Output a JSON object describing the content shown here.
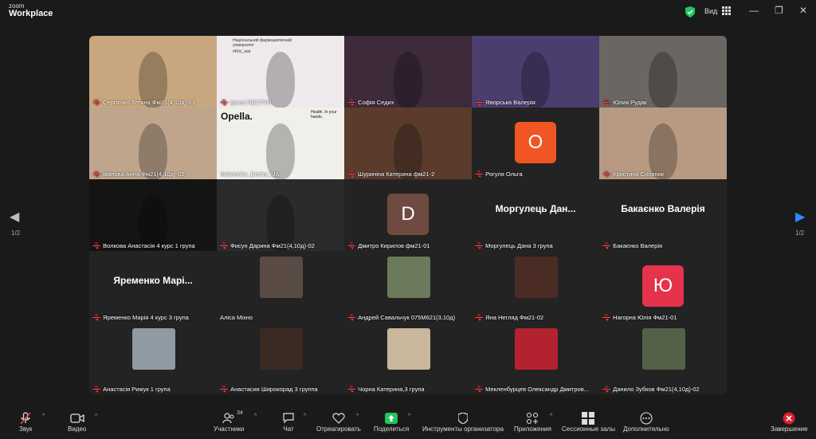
{
  "app": {
    "logo_line1": "zoom",
    "logo_line2": "Workplace",
    "view_label": "Вид"
  },
  "pager": {
    "left_page": "1/2",
    "right_page": "1/2"
  },
  "tiles": [
    {
      "name": "Сергієнко Тетяна Фм21(4,10д)-03",
      "bg": "#c9a77e",
      "muted": true
    },
    {
      "name": "Ірина ПЕСТУН",
      "bg": "#efe9ee",
      "muted": true,
      "slide_text": "Національний фармацевтичний університет",
      "slide_tag": "#Kfs/_stat"
    },
    {
      "name": "Софія Седих",
      "bg": "#3d2a3a",
      "muted": true
    },
    {
      "name": "Яворська Валерія",
      "bg": "#4b3d6e",
      "muted": true
    },
    {
      "name": "Юлия Рудак",
      "bg": "#6a6661",
      "muted": true
    },
    {
      "name": "Іванова Анна Фм21(4,10д)-02",
      "bg": "#bfa58c",
      "muted": true
    },
    {
      "name": "Matvienko_Dmitry_UA",
      "bg": "#f1efe9",
      "muted": false,
      "brand": "Opella.",
      "brand_tag": "Health. In your hands."
    },
    {
      "name": "Шуриніна Катерина фм21-2",
      "bg": "#5a3b2c",
      "muted": true
    },
    {
      "name": "Рогуля Ольга",
      "bg": "#232323",
      "muted": true,
      "initial": "О",
      "initial_color": "#f05523"
    },
    {
      "name": "Кристина Соляник",
      "bg": "#b89a82",
      "muted": true
    },
    {
      "name": "Волкова Анастасія 4 курс 1 група",
      "bg": "#141414",
      "muted": true
    },
    {
      "name": "Фисун Дарина Фм21(4,10д)-02",
      "bg": "#2b2b2b",
      "muted": true
    },
    {
      "name": "Дмитро Кирилов фм21-01",
      "bg": "#232323",
      "muted": true,
      "initial": "D",
      "initial_color": "#6e4a40"
    },
    {
      "name": "Моргулець Дана 3 група",
      "bg": "#232323",
      "muted": true,
      "display_name": "Моргулець Дан..."
    },
    {
      "name": "Бакаєнко Валерія",
      "bg": "#232323",
      "muted": true,
      "display_name": "Бакаєнко Валерія"
    },
    {
      "name": "Яременко Марія 4 курс 3 група",
      "bg": "#232323",
      "muted": true,
      "display_name": "Яременко Марі..."
    },
    {
      "name": "Аліса Міхно",
      "bg": "#232323",
      "muted": false,
      "photo": "#5a4a44"
    },
    {
      "name": "Андрей Савальчук 075М621(3,10д)",
      "bg": "#232323",
      "muted": true,
      "photo": "#6b7a5a"
    },
    {
      "name": "Яна Негляд Фм21-02",
      "bg": "#232323",
      "muted": true,
      "photo": "#4a2c24"
    },
    {
      "name": "Нагорна Юлія Фм21-01",
      "bg": "#232323",
      "muted": true,
      "initial": "Ю",
      "initial_color": "#e5334b"
    },
    {
      "name": "Анастасія Рижук 1 група",
      "bg": "#232323",
      "muted": true,
      "photo": "#8f9aa2"
    },
    {
      "name": "Анастасия Широкорад 3 группа",
      "bg": "#232323",
      "muted": true,
      "photo": "#3a2a22"
    },
    {
      "name": "Чорна Катерина,3 група",
      "bg": "#232323",
      "muted": true,
      "photo": "#c8b79a"
    },
    {
      "name": "Мекленбурцев Олександр Дмитров...",
      "bg": "#232323",
      "muted": true,
      "photo": "#b3222e"
    },
    {
      "name": "Данило Зубков Фм21(4,10д)-02",
      "bg": "#232323",
      "muted": true,
      "photo": "#546048"
    }
  ],
  "toolbar": {
    "audio": "Звук",
    "video": "Видео",
    "participants": "Участники",
    "participants_count": "34",
    "chat": "Чат",
    "react": "Отреагировать",
    "share": "Поделиться",
    "host_tools": "Инструменты организатора",
    "apps": "Приложения",
    "breakout": "Сессионные залы",
    "more": "Дополнительно",
    "end": "Завершение"
  },
  "colors": {
    "accent_green": "#22c55e",
    "end_red": "#e11d2e",
    "share_green": "#22c55e"
  }
}
